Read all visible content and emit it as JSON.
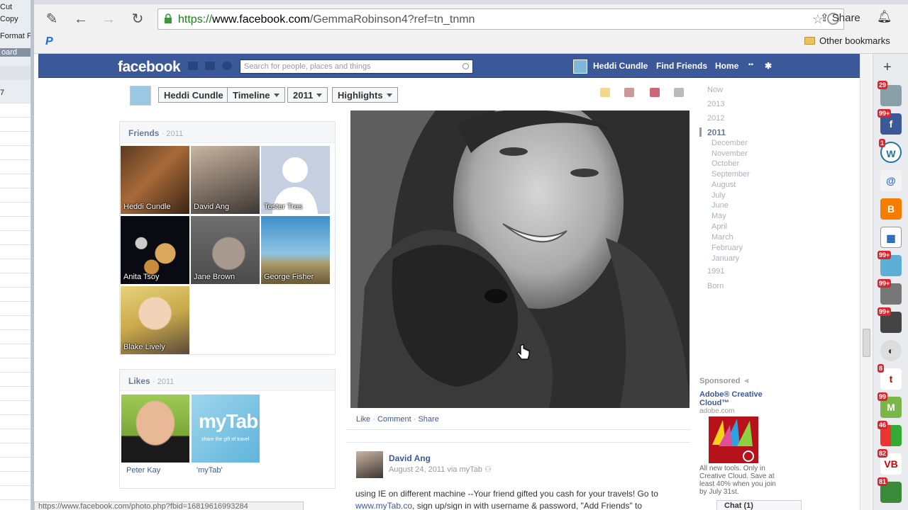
{
  "background_app": {
    "lines": [
      "Cut",
      "Copy",
      "Format P",
      "oard",
      "7"
    ]
  },
  "browser": {
    "url_scheme": "https://",
    "url_domain": "www.facebook.com",
    "url_path": "/GemmaRobinson4?ref=tn_tnmn",
    "share_label": "Share",
    "bookmark_other": "Other bookmarks",
    "status_url": "https://www.facebook.com/photo.php?fbid=16819616993284"
  },
  "fb": {
    "logo": "facebook",
    "search_placeholder": "Search for people, places and things",
    "nav": [
      "Heddi Cundle",
      "Find Friends",
      "Home"
    ]
  },
  "timeline": {
    "name": "Heddi Cundle",
    "tab": "Timeline",
    "year": "2011",
    "view": "Highlights"
  },
  "friends": {
    "title": "Friends",
    "year": "2011",
    "items": [
      "Heddi Cundle",
      "David Ang",
      "Tester Tres",
      "Anita Tsoy",
      "Jane Brown",
      "George Fisher",
      "Blake Lively"
    ]
  },
  "likes": {
    "title": "Likes",
    "year": "2011",
    "items": [
      "Peter Kay",
      "'myTab'"
    ],
    "mytab_logo": "myTab",
    "mytab_tagline": "share the gift of travel"
  },
  "photo_actions": {
    "like": "Like",
    "comment": "Comment",
    "share": "Share",
    "sep": "·"
  },
  "post": {
    "author": "David Ang",
    "meta": "August 24, 2011 via myTab",
    "text": "using IE on different machine --Your friend gifted you cash for your travels! Go to",
    "link": "www.myTab.co",
    "text2": ", sign up/sign in with username & password, \"Add Friends\" to"
  },
  "scrubber": {
    "years": [
      "Now",
      "2013",
      "2012",
      "2011"
    ],
    "months": [
      "December",
      "November",
      "October",
      "September",
      "August",
      "July",
      "June",
      "May",
      "April",
      "March",
      "February",
      "January"
    ],
    "after": [
      "1991",
      "Born"
    ]
  },
  "sponsored": {
    "label": "Sponsored",
    "title": "Adobe® Creative Cloud™",
    "domain": "adobe.com",
    "text": "All new tools. Only in Creative Cloud. Save at least 40% when you join by July 31st."
  },
  "chat": {
    "label": "Chat (1)"
  },
  "bm_badges": [
    "29",
    "99+",
    "1",
    "99+",
    "99+",
    "99+",
    "8",
    "99",
    "46",
    "82",
    "81"
  ],
  "colors": {
    "fb_blue": "#3b5998",
    "chrome_bg": "#f1f1f1",
    "link": "#3b5998"
  }
}
